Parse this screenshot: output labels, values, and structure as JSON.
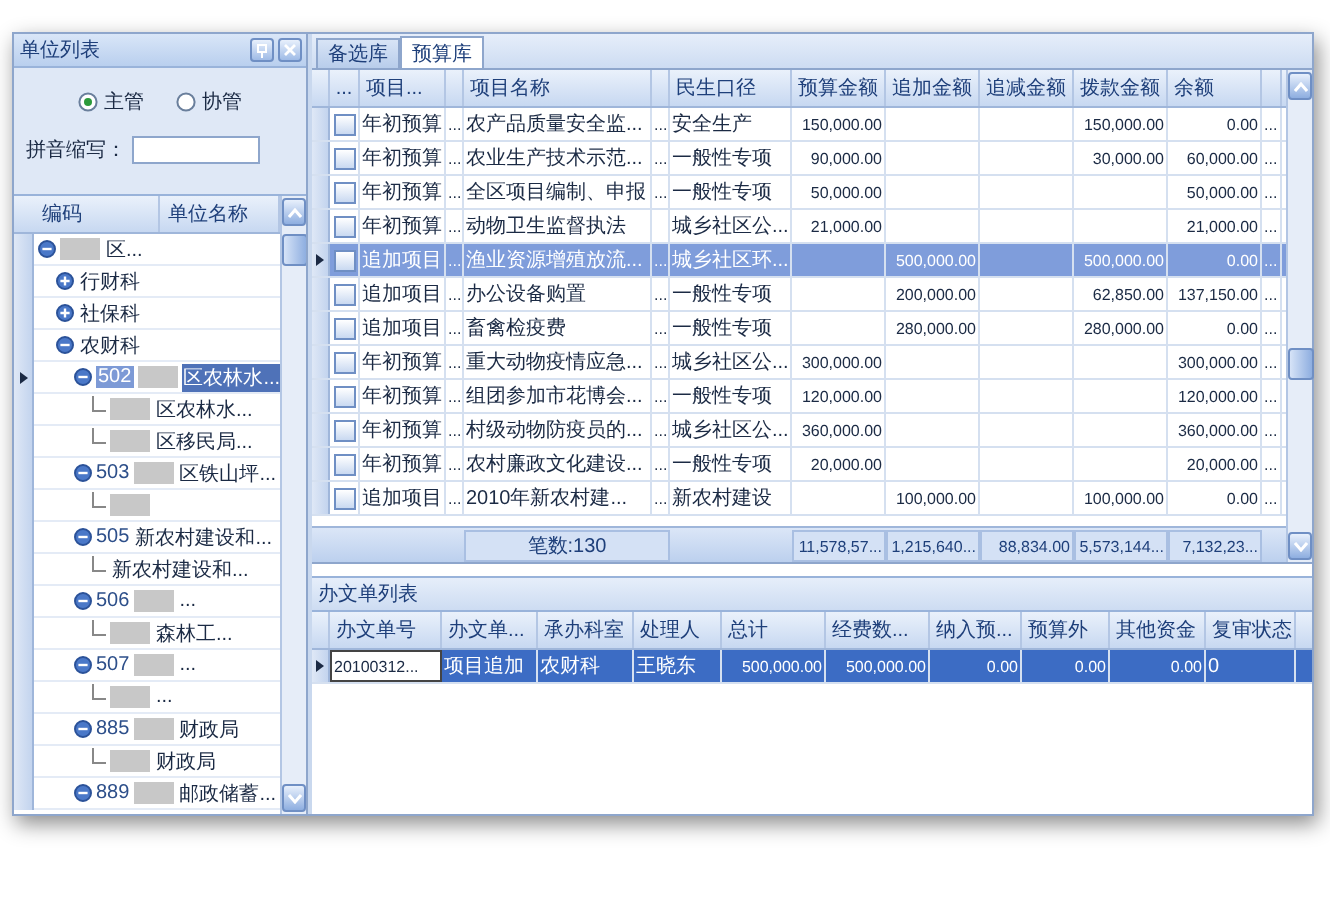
{
  "left_panel": {
    "title": "单位列表",
    "radios": [
      {
        "label": "主管",
        "selected": true
      },
      {
        "label": "协管",
        "selected": false
      }
    ],
    "pinyin_label": "拼音缩写：",
    "tree": {
      "columns": [
        "编码",
        "单位名称"
      ],
      "nodes": [
        {
          "name": "区...",
          "masked": true,
          "selected": false,
          "expanded": true,
          "children": [
            {
              "name": "行财科",
              "masked": false,
              "selected": false,
              "expanded": false
            },
            {
              "name": "社保科",
              "masked": false,
              "selected": false,
              "expanded": false
            },
            {
              "name": "农财科",
              "masked": false,
              "selected": false,
              "expanded": true,
              "children": [
                {
                  "code": "502",
                  "name": "区农林水...",
                  "masked": true,
                  "selected": true,
                  "expanded": true,
                  "children": [
                    {
                      "name": "区农林水...",
                      "masked": true,
                      "selected": false
                    },
                    {
                      "name": "区移民局...",
                      "masked": true,
                      "selected": false
                    }
                  ]
                },
                {
                  "code": "503",
                  "name": "区铁山坪...",
                  "masked": true,
                  "selected": false,
                  "expanded": true,
                  "children": [
                    {
                      "masked": true,
                      "selected": false
                    }
                  ]
                },
                {
                  "code": "505",
                  "name": "新农村建设和...",
                  "masked": false,
                  "selected": false,
                  "expanded": true,
                  "children": [
                    {
                      "name": "新农村建设和...",
                      "masked": false,
                      "selected": false
                    }
                  ]
                },
                {
                  "code": "506",
                  "name": "...",
                  "masked": true,
                  "selected": false,
                  "expanded": true,
                  "children": [
                    {
                      "name": "森林工...",
                      "masked": true,
                      "selected": false
                    }
                  ]
                },
                {
                  "code": "507",
                  "name": "...",
                  "masked": true,
                  "selected": false,
                  "expanded": true,
                  "children": [
                    {
                      "name": "...",
                      "masked": true,
                      "selected": false
                    }
                  ]
                },
                {
                  "code": "885",
                  "name": "财政局",
                  "masked": true,
                  "selected": false,
                  "expanded": true,
                  "children": [
                    {
                      "name": "财政局",
                      "masked": true,
                      "selected": false
                    }
                  ]
                },
                {
                  "code": "889",
                  "name": "邮政储蓄...",
                  "masked": true,
                  "selected": false,
                  "expanded": true
                }
              ]
            }
          ]
        }
      ]
    }
  },
  "tabs": [
    {
      "label": "备选库",
      "selected": false
    },
    {
      "label": "预算库",
      "selected": true
    }
  ],
  "budget_table": {
    "check_header": "...",
    "columns": [
      {
        "label": "项目...",
        "kind": "text"
      },
      {
        "kind": "dots"
      },
      {
        "label": "项目名称",
        "kind": "text"
      },
      {
        "kind": "dots"
      },
      {
        "label": "民生口径",
        "kind": "text"
      },
      {
        "label": "预算金额",
        "kind": "number"
      },
      {
        "label": "追加金额",
        "kind": "number"
      },
      {
        "label": "追减金额",
        "kind": "number"
      },
      {
        "label": "拨款金额",
        "kind": "number"
      },
      {
        "label": "余额",
        "kind": "number"
      },
      {
        "kind": "dots"
      }
    ],
    "rows": [
      {
        "checked": false,
        "selected": false,
        "cells": [
          "年初预算",
          "...",
          "农产品质量安全监...",
          "...",
          "安全生产",
          "150,000.00",
          null,
          null,
          "150,000.00",
          "0.00",
          "..."
        ]
      },
      {
        "checked": false,
        "selected": false,
        "cells": [
          "年初预算",
          "...",
          "农业生产技术示范...",
          "...",
          "一般性专项",
          "90,000.00",
          null,
          null,
          "30,000.00",
          "60,000.00",
          "..."
        ]
      },
      {
        "checked": false,
        "selected": false,
        "cells": [
          "年初预算",
          "...",
          "全区项目编制、申报",
          "...",
          "一般性专项",
          "50,000.00",
          null,
          null,
          null,
          "50,000.00",
          "..."
        ]
      },
      {
        "checked": false,
        "selected": false,
        "cells": [
          "年初预算",
          "...",
          "动物卫生监督执法",
          null,
          "城乡社区公...",
          "21,000.00",
          null,
          null,
          null,
          "21,000.00",
          "..."
        ]
      },
      {
        "checked": false,
        "selected": true,
        "cells": [
          "追加项目",
          "...",
          "渔业资源增殖放流...",
          "...",
          "城乡社区环...",
          null,
          "500,000.00",
          null,
          "500,000.00",
          "0.00",
          "..."
        ]
      },
      {
        "checked": false,
        "selected": false,
        "cells": [
          "追加项目",
          "...",
          "办公设备购置",
          "...",
          "一般性专项",
          null,
          "200,000.00",
          null,
          "62,850.00",
          "137,150.00",
          "..."
        ]
      },
      {
        "checked": false,
        "selected": false,
        "cells": [
          "追加项目",
          "...",
          "畜禽检疫费",
          "...",
          "一般性专项",
          null,
          "280,000.00",
          null,
          "280,000.00",
          "0.00",
          "..."
        ]
      },
      {
        "checked": false,
        "selected": false,
        "cells": [
          "年初预算",
          "...",
          "重大动物疫情应急...",
          "...",
          "城乡社区公...",
          "300,000.00",
          null,
          null,
          null,
          "300,000.00",
          "..."
        ]
      },
      {
        "checked": false,
        "selected": false,
        "cells": [
          "年初预算",
          "...",
          "组团参加市花博会...",
          "...",
          "一般性专项",
          "120,000.00",
          null,
          null,
          null,
          "120,000.00",
          "..."
        ]
      },
      {
        "checked": false,
        "selected": false,
        "cells": [
          "年初预算",
          "...",
          "村级动物防疫员的...",
          "...",
          "城乡社区公...",
          "360,000.00",
          null,
          null,
          null,
          "360,000.00",
          "..."
        ]
      },
      {
        "checked": false,
        "selected": false,
        "cells": [
          "年初预算",
          "...",
          "农村廉政文化建设...",
          "...",
          "一般性专项",
          "20,000.00",
          null,
          null,
          null,
          "20,000.00",
          "..."
        ]
      },
      {
        "checked": false,
        "selected": false,
        "cells": [
          "追加项目",
          "...",
          "2010年新农村建...",
          "...",
          "新农村建设",
          null,
          "100,000.00",
          null,
          "100,000.00",
          "0.00",
          "..."
        ]
      }
    ],
    "footer": {
      "count": "笔数:130",
      "totals": [
        "11,578,57...",
        "1,215,640...",
        "88,834.00",
        "5,573,144...",
        "7,132,23..."
      ]
    }
  },
  "docs_panel": {
    "title": "办文单列表",
    "columns": [
      {
        "label": "办文单号",
        "kind": "text"
      },
      {
        "label": "办文单...",
        "kind": "text"
      },
      {
        "label": "承办科室",
        "kind": "text"
      },
      {
        "label": "处理人",
        "kind": "text"
      },
      {
        "label": "总计",
        "kind": "number"
      },
      {
        "label": "经费数...",
        "kind": "number"
      },
      {
        "label": "纳入预...",
        "kind": "number"
      },
      {
        "label": "预算外",
        "kind": "number"
      },
      {
        "label": "其他资金",
        "kind": "number"
      },
      {
        "label": "复审状态",
        "kind": "text"
      }
    ],
    "rows": [
      {
        "selected": true,
        "cells": [
          "20100312...",
          "项目追加",
          "农财科",
          "王晓东",
          "500,000.00",
          "500,000.00",
          "0.00",
          "0.00",
          "0.00",
          "0"
        ]
      }
    ]
  }
}
